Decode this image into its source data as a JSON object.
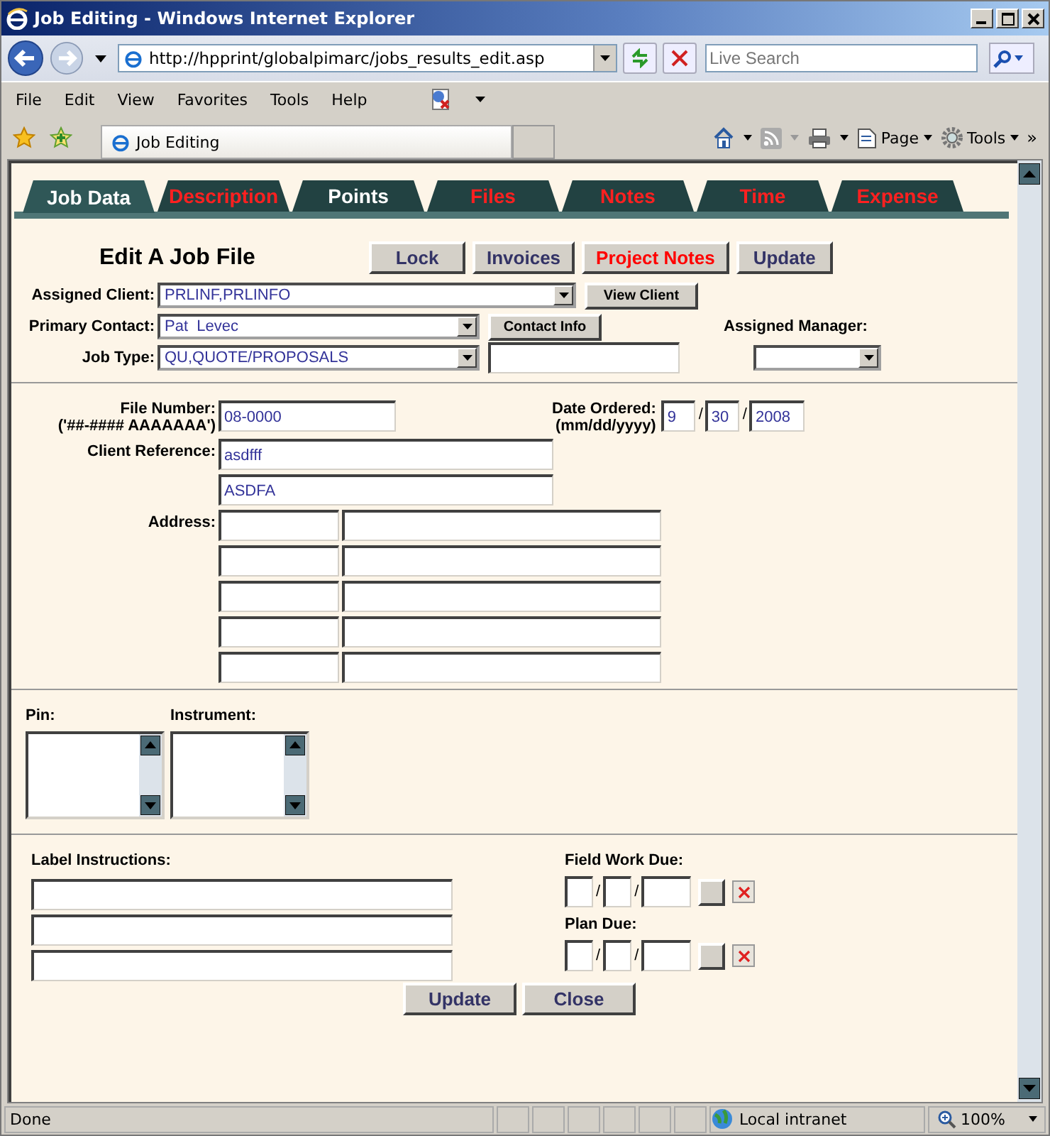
{
  "window": {
    "title": "Job Editing - Windows Internet Explorer"
  },
  "address_bar": {
    "url": "http://hpprint/globalpimarc/jobs_results_edit.asp",
    "search_placeholder": "Live Search"
  },
  "menu": [
    "File",
    "Edit",
    "View",
    "Favorites",
    "Tools",
    "Help"
  ],
  "browser_tab": {
    "title": "Job Editing"
  },
  "command_bar": {
    "page": "Page",
    "tools": "Tools",
    "more": "»"
  },
  "page_tabs": [
    {
      "label": "Job Data",
      "selected": true,
      "highlighted": false
    },
    {
      "label": "Description",
      "selected": false,
      "highlighted": true
    },
    {
      "label": "Points",
      "selected": false,
      "highlighted": false
    },
    {
      "label": "Files",
      "selected": false,
      "highlighted": true
    },
    {
      "label": "Notes",
      "selected": false,
      "highlighted": true
    },
    {
      "label": "Time",
      "selected": false,
      "highlighted": true
    },
    {
      "label": "Expense",
      "selected": false,
      "highlighted": true
    }
  ],
  "heading": "Edit A Job File",
  "action_buttons": [
    {
      "label": "Lock",
      "color": "#333366"
    },
    {
      "label": "Invoices",
      "color": "#333366"
    },
    {
      "label": "Project Notes",
      "color": "#ff0000"
    },
    {
      "label": "Update",
      "color": "#333366"
    }
  ],
  "assigned_client": {
    "label": "Assigned Client:",
    "value": "PRLINF,PRLINFO",
    "button": "View Client"
  },
  "primary_contact": {
    "label": "Primary Contact:",
    "value": "Pat  Levec",
    "button": "Contact Info"
  },
  "job_type": {
    "label": "Job Type:",
    "value": "QU,QUOTE/PROPOSALS"
  },
  "assigned_manager": {
    "label": "Assigned Manager:"
  },
  "file_number": {
    "label": "File Number:",
    "hint": "('##-#### AAAAAAA')",
    "value": "08-0000"
  },
  "date_ordered": {
    "label": "Date Ordered:",
    "hint": "(mm/dd/yyyy)",
    "month": "9",
    "day": "30",
    "year": "2008",
    "separators": [
      "/",
      "/"
    ]
  },
  "client_reference": {
    "label": "Client Reference:",
    "values": [
      "asdfff",
      "ASDFA"
    ]
  },
  "address": {
    "label": "Address:"
  },
  "pin": {
    "label": "Pin:"
  },
  "instrument": {
    "label": "Instrument:"
  },
  "label_instructions": {
    "label": "Label Instructions:"
  },
  "due_dates": [
    {
      "label": "Field Work Due:",
      "separators": [
        "/",
        "/"
      ]
    },
    {
      "label": "Plan Due:",
      "separators": [
        "/",
        "/"
      ]
    }
  ],
  "bottom_buttons": [
    "Update",
    "Close"
  ],
  "status_bar": {
    "text": "Done",
    "zone": "Local intranet",
    "zoom": "100%"
  }
}
